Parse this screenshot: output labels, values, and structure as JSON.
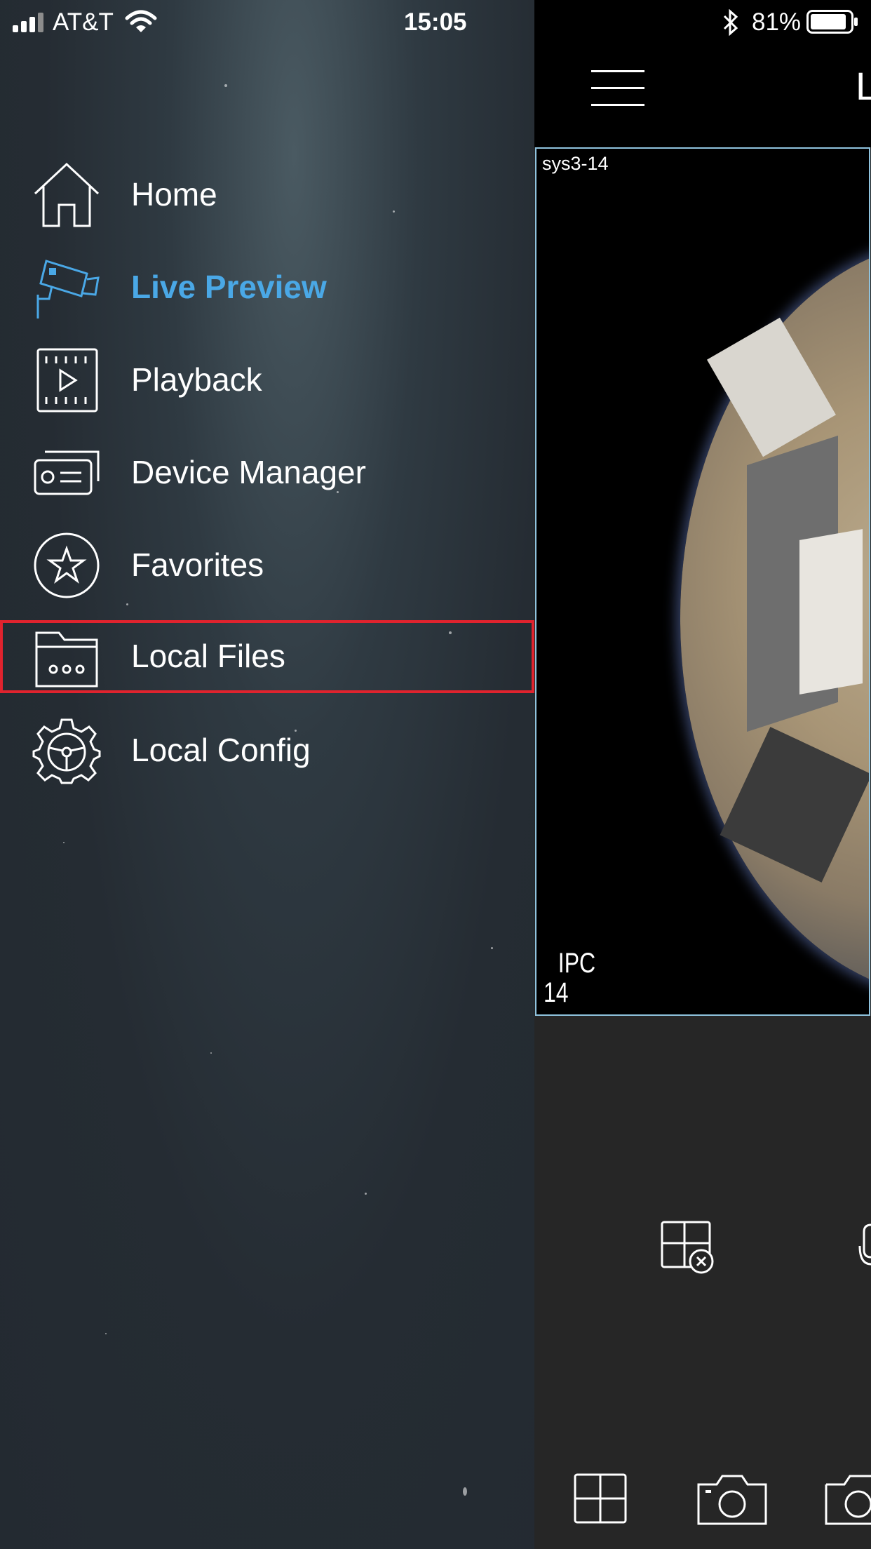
{
  "status_bar": {
    "carrier": "AT&T",
    "time": "15:05",
    "battery": "81%"
  },
  "menu": {
    "items": [
      {
        "label": "Home",
        "icon": "home-icon"
      },
      {
        "label": "Live Preview",
        "icon": "camera-icon",
        "active": true
      },
      {
        "label": "Playback",
        "icon": "playback-icon"
      },
      {
        "label": "Device Manager",
        "icon": "device-icon"
      },
      {
        "label": "Favorites",
        "icon": "star-icon"
      },
      {
        "label": "Local Files",
        "icon": "folder-icon",
        "highlighted": true
      },
      {
        "label": "Local Config",
        "icon": "gear-icon"
      }
    ]
  },
  "header": {
    "title_visible": "L"
  },
  "video": {
    "channel_title": "sys3-14",
    "osd_line1": "IPC",
    "osd_line2": "14"
  },
  "colors": {
    "accent": "#4aa8e6",
    "highlight_border": "#e0232e",
    "video_border": "#8fc3de"
  }
}
